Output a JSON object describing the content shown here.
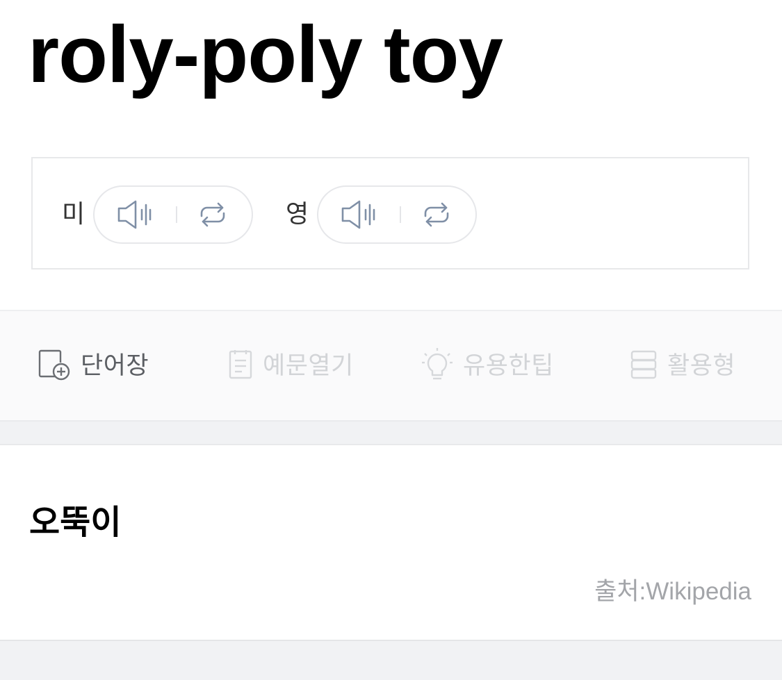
{
  "word": "roly-poly toy",
  "pronunciation": {
    "us": {
      "label": "미"
    },
    "uk": {
      "label": "영"
    }
  },
  "toolbar": {
    "items": [
      {
        "label": "단어장",
        "icon": "add-to-wordbook-icon",
        "enabled": true
      },
      {
        "label": "예문열기",
        "icon": "document-icon",
        "enabled": false
      },
      {
        "label": "유용한팁",
        "icon": "lightbulb-icon",
        "enabled": false
      },
      {
        "label": "활용형",
        "icon": "stack-icon",
        "enabled": false
      }
    ]
  },
  "definition": {
    "meaning": "오뚝이",
    "source": "출처:Wikipedia"
  },
  "colors": {
    "icon": "#7f8fa6",
    "active_text": "#5b5e63",
    "disabled_text": "#d2d4d7",
    "source_text": "#a3a5a9"
  }
}
